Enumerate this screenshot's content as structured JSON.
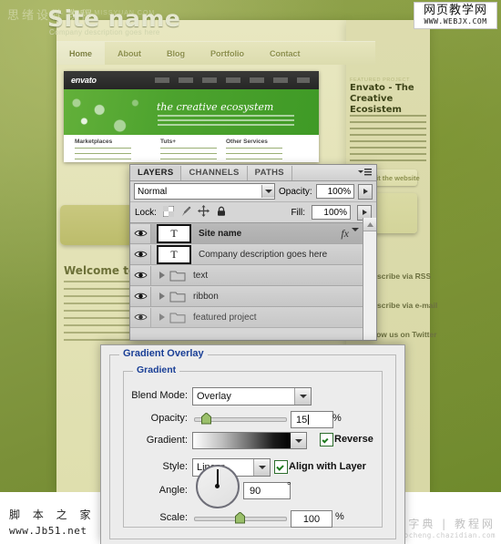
{
  "watermarks": {
    "top_left_cn": "思绪设计教程",
    "top_left_url": "WWW.MISSYUAN.COM",
    "top_right_cn": "网页教学网",
    "top_right_url": "WWW.WEBJX.COM",
    "bottom_left_cn": "脚 本 之 家",
    "bottom_left_url": "www.Jb51.net",
    "bottom_right_cn": "查字典 | 教程网",
    "bottom_right_url": "jiaocheng.chazidian.com"
  },
  "website": {
    "title": "Site name",
    "subtitle": "Company description goes here",
    "nav": [
      "Home",
      "About",
      "Blog",
      "Portfolio",
      "Contact"
    ],
    "screenshot": {
      "logo": "envato",
      "hero_heading": "the creative ecosystem",
      "columns": [
        "Marketplaces",
        "Tuts+",
        "Other Services"
      ]
    },
    "featured": {
      "kicker": "FEATURED PROJECT",
      "title": "Envato - The Creative Ecosistem",
      "button_label": "Visit the website"
    },
    "welcome_title": "Welcome to the",
    "side_links": [
      "Subscribe via RSS",
      "Subscribe via e-mail",
      "Follow us on Twitter"
    ]
  },
  "layers_panel": {
    "tabs": [
      {
        "label": "LAYERS",
        "active": true
      },
      {
        "label": "CHANNELS",
        "active": false
      },
      {
        "label": "PATHS",
        "active": false
      }
    ],
    "blend_mode": "Normal",
    "opacity_label": "Opacity:",
    "opacity_value": "100%",
    "lock_label": "Lock:",
    "fill_label": "Fill:",
    "fill_value": "100%",
    "layers": [
      {
        "name": "Site name",
        "type": "text",
        "thumb": "T",
        "selected": true,
        "has_fx": true
      },
      {
        "name": "Company description goes here",
        "type": "text",
        "thumb": "T",
        "selected": false,
        "has_fx": false
      },
      {
        "name": "text",
        "type": "group",
        "selected": false,
        "has_fx": false
      },
      {
        "name": "ribbon",
        "type": "group",
        "selected": false,
        "has_fx": false
      },
      {
        "name": "featured project",
        "type": "group",
        "selected": false,
        "has_fx": false
      }
    ]
  },
  "gradient_overlay_dialog": {
    "section_title": "Gradient Overlay",
    "group_title": "Gradient",
    "blend_mode_label": "Blend Mode:",
    "blend_mode_value": "Overlay",
    "opacity_label": "Opacity:",
    "opacity_value": "15",
    "opacity_unit": "%",
    "gradient_label": "Gradient:",
    "reverse_label": "Reverse",
    "reverse_checked": true,
    "style_label": "Style:",
    "style_value": "Linear",
    "align_label": "Align with Layer",
    "align_checked": true,
    "angle_label": "Angle:",
    "angle_value": "90",
    "angle_unit": "°",
    "scale_label": "Scale:",
    "scale_value": "100",
    "scale_unit": "%"
  },
  "colors": {
    "accent_blue": "#1a3f96",
    "panel_gray": "#d6d6d6",
    "dialog_gray": "#ececec",
    "site_green": "#7a9038",
    "site_cream": "#e4e3b8"
  }
}
